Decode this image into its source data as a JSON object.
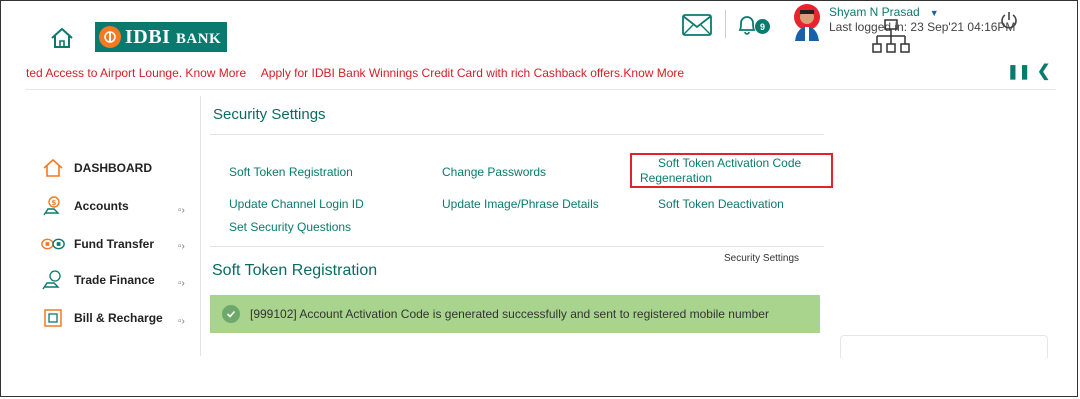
{
  "header": {
    "logo_text": "IDBI",
    "logo_suffix": "BANK",
    "notification_count": "9",
    "user_name": "Shyam N Prasad",
    "last_logged": "Last logged in: 23 Sep'21 04:16PM"
  },
  "ticker": {
    "items": [
      "ted Access to Airport Lounge. Know More",
      "Apply for IDBI Bank Winnings Credit Card with rich Cashback offers.Know More"
    ]
  },
  "sidebar": {
    "items": [
      {
        "label": "DASHBOARD",
        "icon": "home-icon"
      },
      {
        "label": "Accounts",
        "icon": "accounts-icon"
      },
      {
        "label": "Fund Transfer",
        "icon": "fund-transfer-icon"
      },
      {
        "label": "Trade Finance",
        "icon": "trade-finance-icon"
      },
      {
        "label": "Bill & Recharge",
        "icon": "bill-icon"
      }
    ]
  },
  "security": {
    "title": "Security Settings",
    "links": {
      "soft_token_registration": "Soft Token Registration",
      "change_passwords": "Change Passwords",
      "activation_line1": "Soft Token Activation Code",
      "activation_line2": "Regeneration",
      "update_channel": "Update Channel Login ID",
      "update_image": "Update Image/Phrase Details",
      "soft_token_deactivation": "Soft Token Deactivation",
      "set_questions": "Set Security Questions"
    }
  },
  "content": {
    "breadcrumb": "Security Settings",
    "subtitle": "Soft Token Registration",
    "success_message": "[999102] Account Activation Code is generated successfully and sent to registered mobile number"
  },
  "colors": {
    "brand": "#0a7a6e",
    "accent": "#f47a20",
    "ticker": "#d32027",
    "highlight": "#e3232b",
    "success_bg": "#a8d48e"
  }
}
